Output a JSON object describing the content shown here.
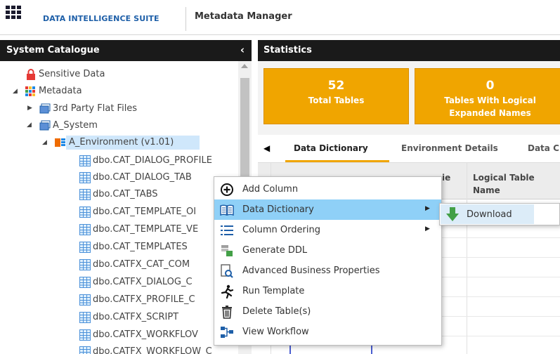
{
  "header": {
    "brand": "DATA INTELLIGENCE SUITE",
    "module": "Metadata Manager"
  },
  "left_panel": {
    "title": "System Catalogue",
    "collapse_glyph": "‹",
    "tree": [
      {
        "label": "Sensitive Data",
        "icon": "lock-icon"
      },
      {
        "label": "Metadata",
        "icon": "metadata-icon"
      },
      {
        "label": "3rd Party Flat Files",
        "icon": "system-icon"
      },
      {
        "label": "A_System",
        "icon": "system-icon"
      },
      {
        "label": "A_Environment (v1.01)",
        "icon": "environment-icon",
        "selected": true
      },
      {
        "label": "dbo.CAT_DIALOG_PROFILE",
        "icon": "table-icon"
      },
      {
        "label": "dbo.CAT_DIALOG_TAB",
        "icon": "table-icon"
      },
      {
        "label": "dbo.CAT_TABS",
        "icon": "table-icon"
      },
      {
        "label": "dbo.CAT_TEMPLATE_OI",
        "icon": "table-icon"
      },
      {
        "label": "dbo.CAT_TEMPLATE_VE",
        "icon": "table-icon"
      },
      {
        "label": "dbo.CAT_TEMPLATES",
        "icon": "table-icon"
      },
      {
        "label": "dbo.CATFX_CAT_COM",
        "icon": "table-icon"
      },
      {
        "label": "dbo.CATFX_DIALOG_C",
        "icon": "table-icon"
      },
      {
        "label": "dbo.CATFX_PROFILE_C",
        "icon": "table-icon"
      },
      {
        "label": "dbo.CATFX_SCRIPT",
        "icon": "table-icon"
      },
      {
        "label": "dbo.CATFX_WORKFLOV",
        "icon": "table-icon"
      },
      {
        "label": "dbo.CATFX_WORKFLOW_C",
        "icon": "table-icon"
      }
    ]
  },
  "right_panel": {
    "title": "Statistics",
    "cards": [
      {
        "value": "52",
        "label": "Total Tables"
      },
      {
        "value": "0",
        "label_line1": "Tables With Logical",
        "label_line2": "Expanded Names"
      }
    ],
    "tabs": [
      {
        "label": "Data Dictionary",
        "active": true
      },
      {
        "label": "Environment Details"
      },
      {
        "label": "Data C"
      }
    ],
    "columns": [
      {
        "label": "ie"
      },
      {
        "label_line1": "Logical Table",
        "label_line2": "Name"
      }
    ],
    "accent_color": "#f0a500"
  },
  "context_menu": {
    "items": [
      {
        "label": "Add Column",
        "icon": "plus-circle-icon"
      },
      {
        "label": "Data Dictionary",
        "icon": "book-icon",
        "submenu": true,
        "highlighted": true
      },
      {
        "label": "Column Ordering",
        "icon": "list-icon",
        "submenu": true
      },
      {
        "label": "Generate DDL",
        "icon": "ddl-icon"
      },
      {
        "label": "Advanced Business Properties",
        "icon": "properties-icon"
      },
      {
        "label": "Run Template",
        "icon": "run-icon"
      },
      {
        "label": "Delete Table(s)",
        "icon": "trash-icon"
      },
      {
        "label": "View Workflow",
        "icon": "workflow-icon"
      }
    ],
    "submenu": {
      "label": "Download",
      "icon": "download-arrow-icon"
    }
  }
}
